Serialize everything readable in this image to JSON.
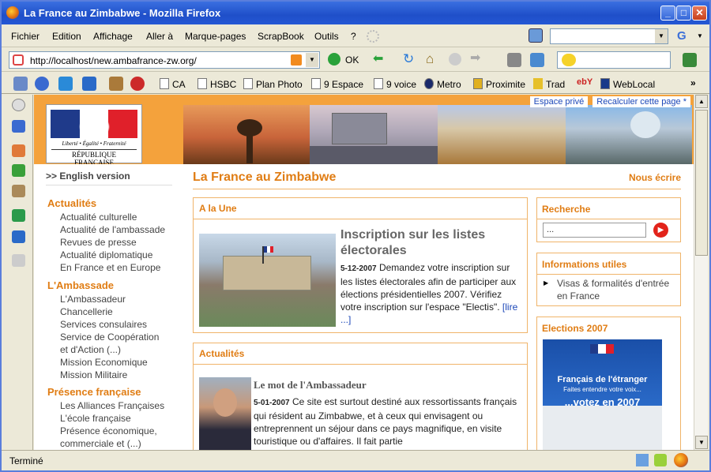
{
  "window": {
    "title": "La France au Zimbabwe - Mozilla Firefox"
  },
  "menu": {
    "items": [
      "Fichier",
      "Edition",
      "Affichage",
      "Aller à",
      "Marque-pages",
      "ScrapBook",
      "Outils",
      "?"
    ]
  },
  "nav": {
    "url": "http://localhost/new.ambafrance-zw.org/",
    "ok_label": "OK",
    "search_engine": "G"
  },
  "bookmarks": [
    "CA",
    "HSBC",
    "Plan Photo",
    "9 Espace",
    "9 voice",
    "Metro",
    "Proximite",
    "Trad",
    "WebLocal"
  ],
  "status": {
    "text": "Terminé"
  },
  "site": {
    "logo_line1": "Liberté • Égalité • Fraternité",
    "logo_line2": "RÉPUBLIQUE FRANÇAISE",
    "top_links": [
      "Espace privé",
      "Recalculer cette page *"
    ],
    "english": ">> English version",
    "page_title": "La France au Zimbabwe",
    "contact": "Nous écrire"
  },
  "leftnav": {
    "sections": [
      {
        "title": "Actualités",
        "items": [
          "Actualité culturelle",
          "Actualité de l'ambassade",
          "Revues de presse",
          "Actualité diplomatique",
          "En France et en Europe"
        ]
      },
      {
        "title": "L'Ambassade",
        "items": [
          "L'Ambassadeur",
          "Chancellerie",
          "Services consulaires",
          "Service de Coopération",
          "et d'Action (...)",
          "Mission Economique",
          "Mission Militaire"
        ]
      },
      {
        "title": "Présence française",
        "items": [
          "Les Alliances Françaises",
          "L'école française",
          "Présence économique,",
          "commerciale et (...)"
        ]
      }
    ]
  },
  "une": {
    "header": "A la Une",
    "title": "Inscription sur les listes électorales",
    "date": "5-12-2007",
    "text": "Demandez votre inscription sur les listes électorales afin de participer aux élections présidentielles 2007. Vérifiez votre inscription sur l'espace \"Electis\".",
    "more": "[lire ...]"
  },
  "actualites": {
    "header": "Actualités",
    "title": "Le mot de l'Ambassadeur",
    "date": "5-01-2007",
    "text": "Ce site est surtout destiné aux ressortissants français qui résident au Zimbabwe, et à ceux qui envisagent ou entreprennent un séjour dans ce pays magnifique, en visite touristique ou d'affaires. Il fait partie"
  },
  "recherche": {
    "header": "Recherche",
    "placeholder": "..."
  },
  "infos": {
    "header": "Informations utiles",
    "item": "Visas & formalités d'entrée en France"
  },
  "elections": {
    "header": "Elections 2007",
    "poster_line1": "Français de l'étranger",
    "poster_line2": "Faites entendre votre voix...",
    "poster_line3": "...votez en 2007"
  },
  "colors": {
    "accent": "#e07d14",
    "orange_bar": "#f4a23c",
    "link": "#1c47b8"
  }
}
